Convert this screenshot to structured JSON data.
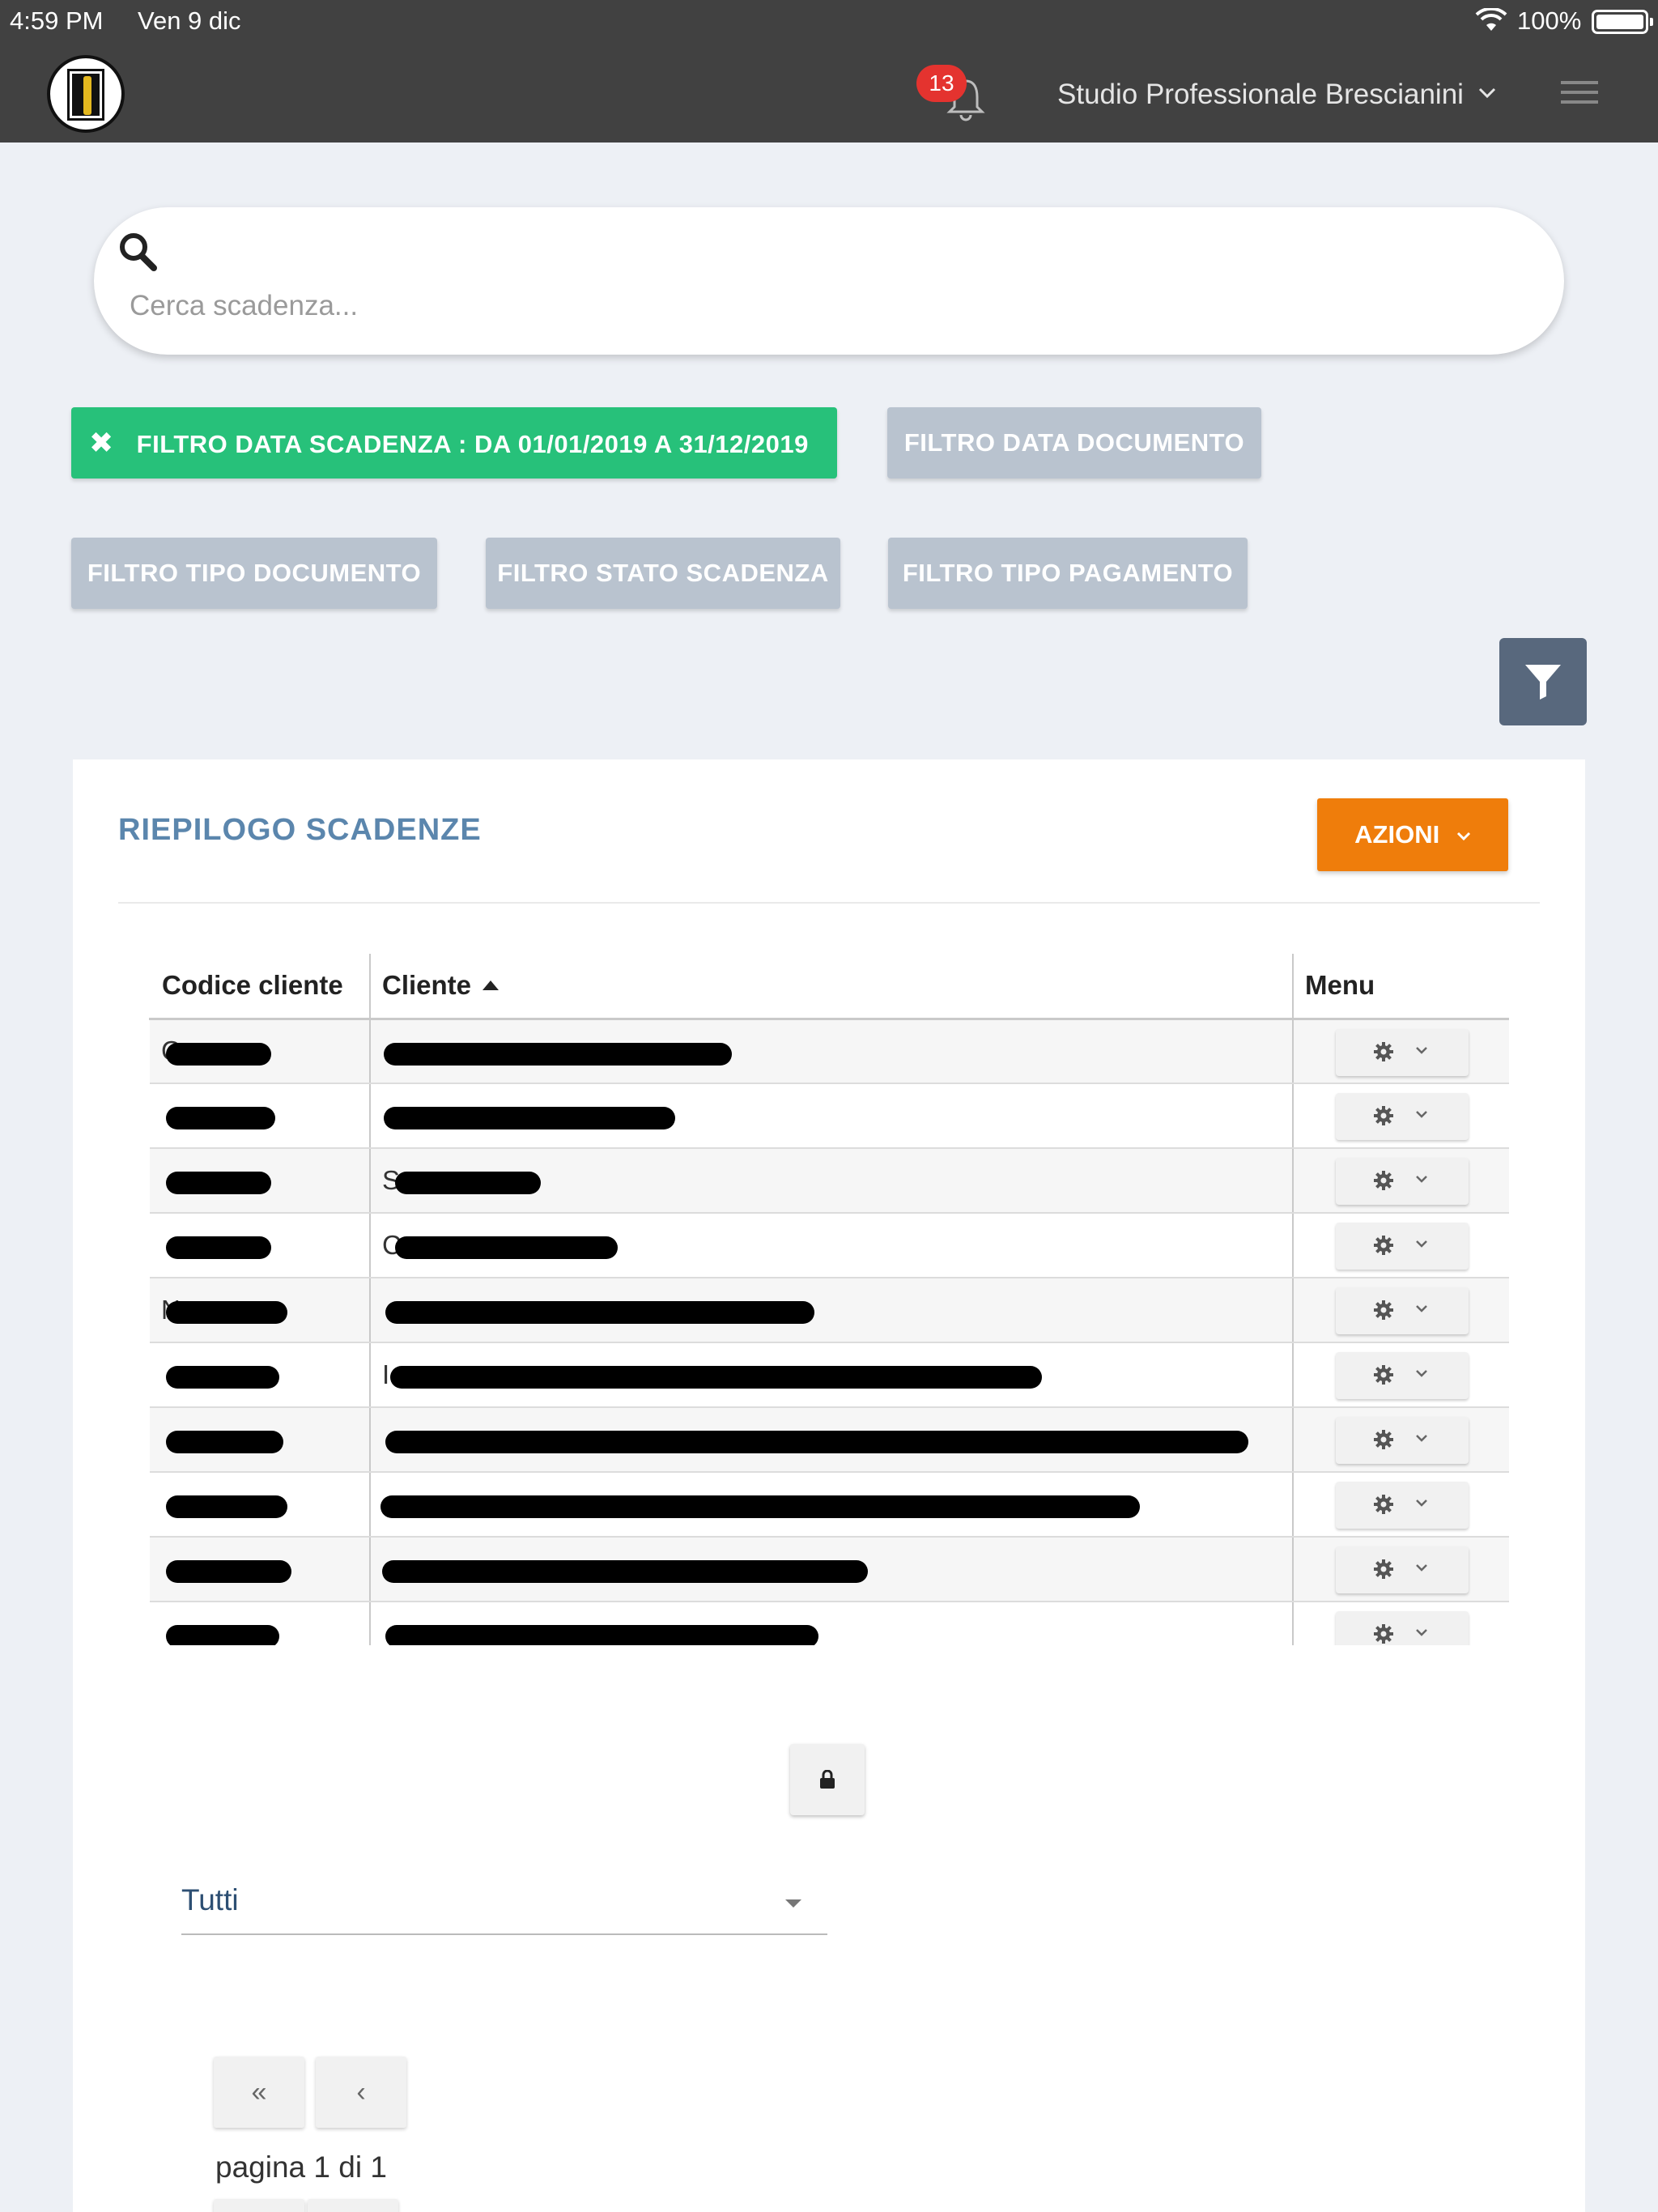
{
  "status_bar": {
    "time": "4:59 PM",
    "date": "Ven 9 dic",
    "battery": "100%"
  },
  "navbar": {
    "notifications_count": "13",
    "studio_name": "Studio Professionale Brescianini"
  },
  "search": {
    "placeholder": "Cerca scadenza..."
  },
  "filters": {
    "active": {
      "label": "FILTRO DATA SCADENZA : ",
      "value": "DA 01/01/2019 A 31/12/2019"
    },
    "data_documento": "FILTRO DATA DOCUMENTO",
    "tipo_documento": "FILTRO TIPO DOCUMENTO",
    "stato_scadenza": "FILTRO STATO SCADENZA",
    "tipo_pagamento": "FILTRO TIPO PAGAMENTO"
  },
  "card": {
    "title": "RIEPILOGO SCADENZE",
    "azioni_label": "AZIONI"
  },
  "table": {
    "headers": {
      "code": "Codice cliente",
      "client": "Cliente",
      "menu": "Menu"
    },
    "rows": [
      {
        "code": "C",
        "client": ""
      },
      {
        "code": "",
        "client": ""
      },
      {
        "code": "",
        "client": "S"
      },
      {
        "code": "",
        "client": "C"
      },
      {
        "code": "N",
        "client": ""
      },
      {
        "code": "",
        "client": "I"
      },
      {
        "code": "",
        "client": ""
      },
      {
        "code": "",
        "client": ""
      },
      {
        "code": "",
        "client": ""
      },
      {
        "code": "",
        "client": ""
      }
    ]
  },
  "page_size_select": {
    "value": "Tutti"
  },
  "pagination": {
    "label": "pagina 1 di 1",
    "first": "«",
    "prev": "‹",
    "next": "›",
    "last": "»"
  },
  "colors": {
    "topbar": "#414141",
    "active_filter": "#27c17a",
    "inactive_filter": "#b9c3cf",
    "azioni": "#ef7d0b",
    "title": "#5b86ad",
    "badge": "#e4332f"
  }
}
